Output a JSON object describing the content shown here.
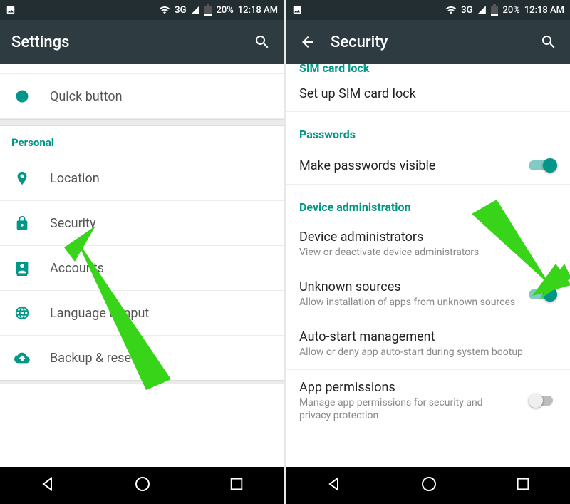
{
  "status": {
    "network": "3G",
    "battery": "20%",
    "time": "12:18 AM"
  },
  "left": {
    "title": "Settings",
    "items": {
      "quick_button": "Quick button",
      "location": "Location",
      "security": "Security",
      "accounts": "Accounts",
      "language": "Language & input",
      "backup": "Backup & reset"
    },
    "section_personal": "Personal"
  },
  "right": {
    "title": "Security",
    "truncated_header": "SIM card lock",
    "sim": {
      "title": "Set up SIM card lock"
    },
    "section_passwords": "Passwords",
    "passwords_visible": {
      "title": "Make passwords visible"
    },
    "section_device_admin": "Device administration",
    "device_admins": {
      "title": "Device administrators",
      "sub": "View or deactivate device administrators"
    },
    "unknown_sources": {
      "title": "Unknown sources",
      "sub": "Allow installation of apps from unknown sources"
    },
    "autostart": {
      "title": "Auto-start management",
      "sub": "Allow or deny app auto-start during system bootup"
    },
    "app_permissions": {
      "title": "App permissions",
      "sub": "Manage app permissions for security and privacy protection"
    }
  }
}
